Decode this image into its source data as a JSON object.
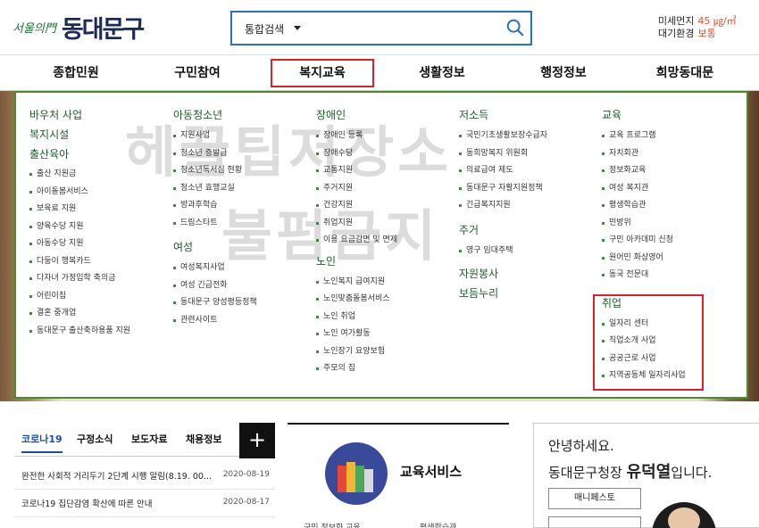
{
  "header": {
    "logo_script": "서울의門",
    "logo_name": "동대문구",
    "search_scope": "통합검색",
    "air": [
      {
        "label": "미세먼지",
        "value": "45 ㎍/㎥"
      },
      {
        "label": "대기환경",
        "value": "보통"
      }
    ]
  },
  "gnb": [
    "종합민원",
    "구민참여",
    "복지교육",
    "생활정보",
    "행정정보",
    "희망동대문"
  ],
  "mega": {
    "col1": {
      "h1": "바우처 사업",
      "h2": "복지시설",
      "h3": "출산육아",
      "items": [
        "출산 지원금",
        "아이돌봄서비스",
        "보육료 지원",
        "양육수당 지원",
        "아동수당 지원",
        "다둥이 행복카드",
        "다자녀 가정입학 축의금",
        "어린이집",
        "결혼 중개업",
        "동대문구 출산축하용품 지원"
      ]
    },
    "col2": {
      "h1": "아동청소년",
      "items1": [
        "지원사업",
        "청소년 증발급",
        "청소년독서심 현황",
        "청소년 효행교실",
        "방과후학습",
        "드림스타트"
      ],
      "h2": "여성",
      "items2": [
        "여성복지사업",
        "여성 긴급전화",
        "동대문구 양성평등정책",
        "관련사이트"
      ]
    },
    "col3": {
      "h1": "장애인",
      "items1": [
        "장애인 등록",
        "장애수당",
        "교통지원",
        "주거지원",
        "건강지원",
        "취업지원",
        "이용 요금감면 및 면제"
      ],
      "h2": "노인",
      "items2": [
        "노인복지 급여지원",
        "노인맞춤돌봄서비스",
        "노인 취업",
        "노인 여가활동",
        "노인장기 요양보험",
        "주모의 집"
      ]
    },
    "col4": {
      "h1": "저소득",
      "items1": [
        "국민기초생활보장수급자",
        "동희망복지 위원회",
        "의료급여 제도",
        "동대문구 자활지원정책",
        "긴급복지지원"
      ],
      "h2": "주거",
      "items2": [
        "영구 임대주택"
      ],
      "h3": "자원봉사",
      "h4": "보듬누리"
    },
    "col5": {
      "h1": "교육",
      "items1": [
        "교육 프로그램",
        "자치회관",
        "정보화교육",
        "여성 복지관",
        "평생학습관",
        "민방위",
        "구민 아카데미 신청",
        "원어민 화상영어",
        "동국 전문대"
      ],
      "h2": "취업",
      "items2": [
        "일자리 센터",
        "직업소개 사업",
        "공공근로 사업",
        "지역공동체 일자리사업"
      ]
    }
  },
  "watermark": [
    "헤꿀팁저장소",
    "불펌금지"
  ],
  "news": {
    "tabs": [
      "코로나19",
      "구정소식",
      "보도자료",
      "채용정보"
    ],
    "plus": "+",
    "rows": [
      {
        "title": "완전한 사회적 거리두기 2단계 시행 알림(8.19. 00...",
        "date": "2020-08-19"
      },
      {
        "title": "코로나19 집단감염 확산에 따른 안내",
        "date": "2020-08-17"
      }
    ]
  },
  "edu": {
    "title": "교육서비스",
    "foot1": "구민 정보화 교육",
    "foot2": "평생학습관"
  },
  "greeting": {
    "line1": "안녕하세요.",
    "line2_pre": "동대문구청장 ",
    "line2_name": "유덕열",
    "line2_post": "입니다.",
    "button": "매니페스토"
  }
}
